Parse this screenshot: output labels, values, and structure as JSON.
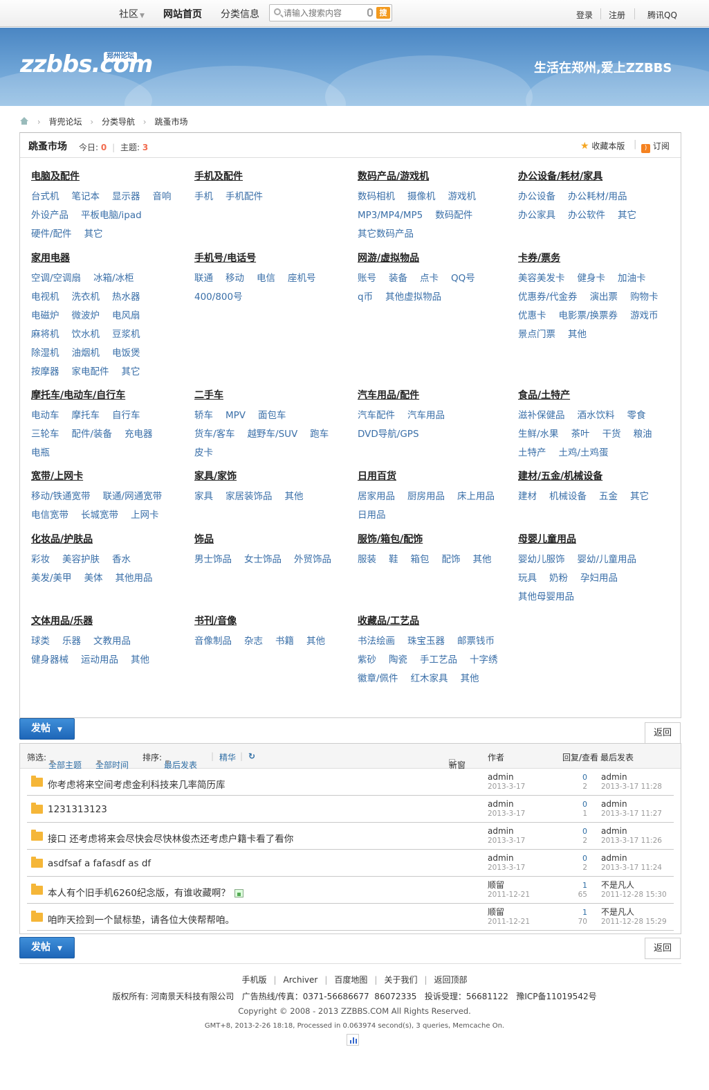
{
  "topbar": {
    "community": "社区",
    "home": "网站首页",
    "classified": "分类信息",
    "search_placeholder": "请输入搜索内容",
    "search_button": "搜",
    "login": "登录",
    "register": "注册",
    "qq": "腾讯QQ"
  },
  "banner": {
    "logo": "zzbbs.com",
    "logo_tag": "郑州论坛",
    "slogan": "生活在郑州,爱上ZZBBS"
  },
  "breadcrumb": [
    "背兜论坛",
    "分类导航",
    "跳蚤市场"
  ],
  "forum": {
    "name": "跳蚤市场",
    "today_label": "今日:",
    "today_value": "0",
    "threads_label": "主题:",
    "threads_value": "3",
    "favorite": "收藏本版",
    "rss_icon": "rss-icon",
    "subscribe": "订阅"
  },
  "categories": [
    {
      "title": "电脑及配件",
      "items": [
        "台式机",
        "笔记本",
        "显示器",
        "音响",
        "外设产品",
        "平板电脑/ipad",
        "硬件/配件",
        "其它"
      ]
    },
    {
      "title": "手机及配件",
      "items": [
        "手机",
        "手机配件"
      ]
    },
    {
      "title": "数码产品/游戏机",
      "items": [
        "数码相机",
        "摄像机",
        "游戏机",
        "MP3/MP4/MP5",
        "数码配件",
        "其它数码产品"
      ]
    },
    {
      "title": "办公设备/耗材/家具",
      "items": [
        "办公设备",
        "办公耗材/用品",
        "办公家具",
        "办公软件",
        "其它"
      ]
    },
    {
      "title": "家用电器",
      "items": [
        "空调/空调扇",
        "冰箱/冰柜",
        "电视机",
        "洗衣机",
        "热水器",
        "电磁炉",
        "微波炉",
        "电风扇",
        "麻将机",
        "饮水机",
        "豆浆机",
        "除湿机",
        "油烟机",
        "电饭煲",
        "按摩器",
        "家电配件",
        "其它"
      ]
    },
    {
      "title": "手机号/电话号",
      "items": [
        "联通",
        "移动",
        "电信",
        "座机号",
        "400/800号"
      ]
    },
    {
      "title": "网游/虚拟物品",
      "items": [
        "账号",
        "装备",
        "点卡",
        "QQ号",
        "q币",
        "其他虚拟物品"
      ]
    },
    {
      "title": "卡券/票务",
      "items": [
        "美容美发卡",
        "健身卡",
        "加油卡",
        "优惠券/代金券",
        "演出票",
        "购物卡",
        "优惠卡",
        "电影票/换票券",
        "游戏币",
        "景点门票",
        "其他"
      ]
    },
    {
      "title": "摩托车/电动车/自行车",
      "items": [
        "电动车",
        "摩托车",
        "自行车",
        "三轮车",
        "配件/装备",
        "充电器",
        "电瓶"
      ]
    },
    {
      "title": "二手车",
      "items": [
        "轿车",
        "MPV",
        "面包车",
        "货车/客车",
        "越野车/SUV",
        "跑车",
        "皮卡"
      ]
    },
    {
      "title": "汽车用品/配件",
      "items": [
        "汽车配件",
        "汽车用品",
        "DVD导航/GPS"
      ]
    },
    {
      "title": "食品/土特产",
      "items": [
        "滋补保健品",
        "酒水饮料",
        "零食",
        "生鲜/水果",
        "茶叶",
        "干货",
        "粮油",
        "土特产",
        "土鸡/土鸡蛋"
      ]
    },
    {
      "title": "宽带/上网卡",
      "items": [
        "移动/铁通宽带",
        "联通/网通宽带",
        "电信宽带",
        "长城宽带",
        "上网卡"
      ]
    },
    {
      "title": "家具/家饰",
      "items": [
        "家具",
        "家居装饰品",
        "其他"
      ]
    },
    {
      "title": "日用百货",
      "items": [
        "居家用品",
        "厨房用品",
        "床上用品",
        "日用品"
      ]
    },
    {
      "title": "建材/五金/机械设备",
      "items": [
        "建材",
        "机械设备",
        "五金",
        "其它"
      ]
    },
    {
      "title": "化妆品/护肤品",
      "items": [
        "彩妆",
        "美容护肤",
        "香水",
        "美发/美甲",
        "美体",
        "其他用品"
      ]
    },
    {
      "title": "饰品",
      "items": [
        "男士饰品",
        "女士饰品",
        "外贸饰品"
      ]
    },
    {
      "title": "服饰/箱包/配饰",
      "items": [
        "服装",
        "鞋",
        "箱包",
        "配饰",
        "其他"
      ]
    },
    {
      "title": "母婴儿童用品",
      "items": [
        "婴幼儿服饰",
        "婴幼/儿童用品",
        "玩具",
        "奶粉",
        "孕妇用品",
        "其他母婴用品"
      ]
    },
    {
      "title": "文体用品/乐器",
      "items": [
        "球类",
        "乐器",
        "文教用品",
        "健身器械",
        "运动用品",
        "其他"
      ]
    },
    {
      "title": "书刊/音像",
      "items": [
        "音像制品",
        "杂志",
        "书籍",
        "其他"
      ]
    },
    {
      "title": "收藏品/工艺品",
      "items": [
        "书法绘画",
        "珠宝玉器",
        "邮票钱币",
        "紫砂",
        "陶瓷",
        "手工艺品",
        "十字绣",
        "徽章/佩件",
        "红木家具",
        "其他"
      ]
    }
  ],
  "actions": {
    "post": "发帖",
    "back": "返回"
  },
  "filter": {
    "label": "筛选:",
    "all_topics": "全部主题",
    "all_time": "全部时间",
    "sort_label": "排序:",
    "sort_value": "最后发表",
    "digest": "精华",
    "refresh_icon": "refresh-icon",
    "new_window": "新窗",
    "author_col": "作者",
    "replies_col": "回复/查看",
    "last_col": "最后发表"
  },
  "threads": [
    {
      "title": "你考虑将来空间考虑金利科技来几率简历库",
      "author": "admin",
      "date": "2013-3-17",
      "replies": "0",
      "views": "2",
      "last_user": "admin",
      "last_time": "2013-3-17 11:28",
      "has_image": false
    },
    {
      "title": "1231313123",
      "author": "admin",
      "date": "2013-3-17",
      "replies": "0",
      "views": "1",
      "last_user": "admin",
      "last_time": "2013-3-17 11:27",
      "has_image": false
    },
    {
      "title": "接口 还考虑将来会尽快会尽快林俊杰还考虑户籍卡看了看你",
      "author": "admin",
      "date": "2013-3-17",
      "replies": "0",
      "views": "2",
      "last_user": "admin",
      "last_time": "2013-3-17 11:26",
      "has_image": false
    },
    {
      "title": "asdfsaf a fafasdf as df",
      "author": "admin",
      "date": "2013-3-17",
      "replies": "0",
      "views": "2",
      "last_user": "admin",
      "last_time": "2013-3-17 11:24",
      "has_image": false
    },
    {
      "title": "本人有个旧手机6260纪念版，有谁收藏啊？",
      "author": "顺留",
      "date": "2011-12-21",
      "replies": "1",
      "views": "65",
      "last_user": "不是凡人",
      "last_time": "2011-12-28 15:30",
      "has_image": true
    },
    {
      "title": "咱昨天捡到一个鼠标垫，请各位大侠帮帮咱。",
      "author": "顺留",
      "date": "2011-12-21",
      "replies": "1",
      "views": "70",
      "last_user": "不是凡人",
      "last_time": "2011-12-28 15:29",
      "has_image": false
    }
  ],
  "footer": {
    "links": [
      "手机版",
      "Archiver",
      "百度地图",
      "关于我们",
      "返回顶部"
    ],
    "line1": "版权所有: 河南景天科技有限公司   广告热线/传真：0371-56686677  86072335   投诉受理：56681122   豫ICP备11019542号",
    "line2": "Copyright © 2008 - 2013 ZZBBS.COM All Rights Reserved.",
    "line3": "GMT+8, 2013-2-26 18:18, Processed in 0.063974 second(s), 3 queries, Memcache On.",
    "stats_icon": "cnzz-icon"
  }
}
